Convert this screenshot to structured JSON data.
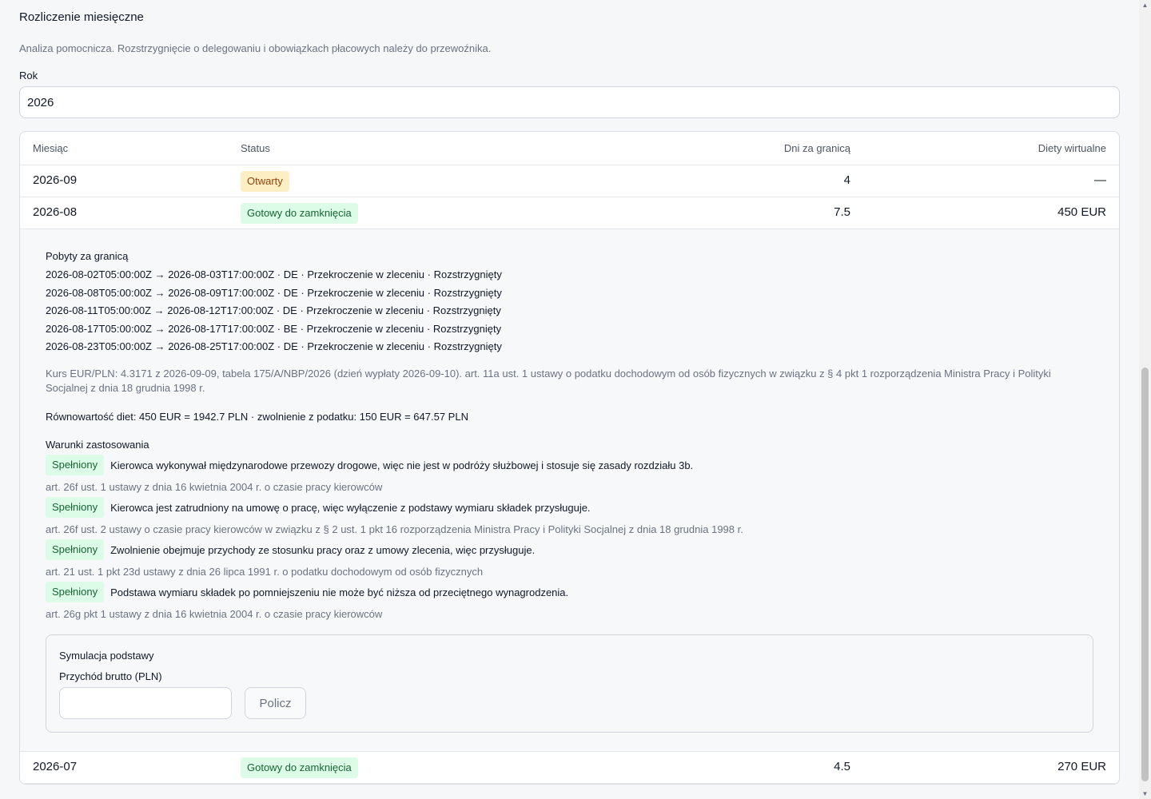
{
  "header": {
    "title": "Rozliczenie miesięczne",
    "subtitle": "Analiza pomocnicza. Rozstrzygnięcie o delegowaniu i obowiązkach płacowych należy do przewoźnika."
  },
  "year": {
    "label": "Rok",
    "value": "2026"
  },
  "table": {
    "columns": [
      "Miesiąc",
      "Status",
      "Dni za granicą",
      "Diety wirtualne"
    ],
    "rows": [
      {
        "month": "2026-09",
        "status": "Otwarty",
        "days": "4",
        "diets": "—"
      },
      {
        "month": "2026-08",
        "status": "Gotowy do zamknięcia",
        "days": "7.5",
        "diets": "450 EUR"
      },
      {
        "month": "2026-07",
        "status": "Gotowy do zamknięcia",
        "days": "4.5",
        "diets": "270 EUR"
      }
    ]
  },
  "details": {
    "stays_heading": "Pobyty za granicą",
    "stays": [
      "2026-08-02T05:00:00Z → 2026-08-03T17:00:00Z · DE · Przekroczenie w zleceniu · Rozstrzygnięty",
      "2026-08-08T05:00:00Z → 2026-08-09T17:00:00Z · DE · Przekroczenie w zleceniu · Rozstrzygnięty",
      "2026-08-11T05:00:00Z → 2026-08-12T17:00:00Z · DE · Przekroczenie w zleceniu · Rozstrzygnięty",
      "2026-08-17T05:00:00Z → 2026-08-17T17:00:00Z · BE · Przekroczenie w zleceniu · Rozstrzygnięty",
      "2026-08-23T05:00:00Z → 2026-08-25T17:00:00Z · DE · Przekroczenie w zleceniu · Rozstrzygnięty"
    ],
    "rate_note": "Kurs EUR/PLN: 4.3171 z 2026-09-09, tabela 175/A/NBP/2026 (dzień wypłaty 2026-09-10). art. 11a ust. 1 ustawy o podatku dochodowym od osób fizycznych w związku z § 4 pkt 1 rozporządzenia Ministra Pracy i Polityki Socjalnej z dnia 18 grudnia 1998 r.",
    "equivalent": "Równowartość diet: 450 EUR = 1942.7 PLN · zwolnienie z podatku: 150 EUR = 647.57 PLN",
    "conditions_heading": "Warunki zastosowania",
    "conditions": [
      {
        "badge": "Spełniony",
        "text": "Kierowca wykonywał międzynarodowe przewozy drogowe, więc nie jest w podróży służbowej i stosuje się zasady rozdziału 3b.",
        "basis": "art. 26f ust. 1 ustawy z dnia 16 kwietnia 2004 r. o czasie pracy kierowców"
      },
      {
        "badge": "Spełniony",
        "text": "Kierowca jest zatrudniony na umowę o pracę, więc wyłączenie z podstawy wymiaru składek przysługuje.",
        "basis": "art. 26f ust. 2 ustawy o czasie pracy kierowców w związku z § 2 ust. 1 pkt 16 rozporządzenia Ministra Pracy i Polityki Socjalnej z dnia 18 grudnia 1998 r."
      },
      {
        "badge": "Spełniony",
        "text": "Zwolnienie obejmuje przychody ze stosunku pracy oraz z umowy zlecenia, więc przysługuje.",
        "basis": "art. 21 ust. 1 pkt 23d ustawy z dnia 26 lipca 1991 r. o podatku dochodowym od osób fizycznych"
      },
      {
        "badge": "Spełniony",
        "text": "Podstawa wymiaru składek po pomniejszeniu nie może być niższa od przeciętnego wynagrodzenia.",
        "basis": "art. 26g pkt 1 ustawy z dnia 16 kwietnia 2004 r. o czasie pracy kierowców"
      }
    ],
    "simulation": {
      "title": "Symulacja podstawy",
      "input_label": "Przychód brutto (PLN)",
      "input_value": "",
      "button_label": "Policz"
    }
  },
  "colors": {
    "open_badge_bg": "#fdefc3",
    "ready_badge_bg": "#dcfce7",
    "ready_badge_text": "#166534"
  }
}
